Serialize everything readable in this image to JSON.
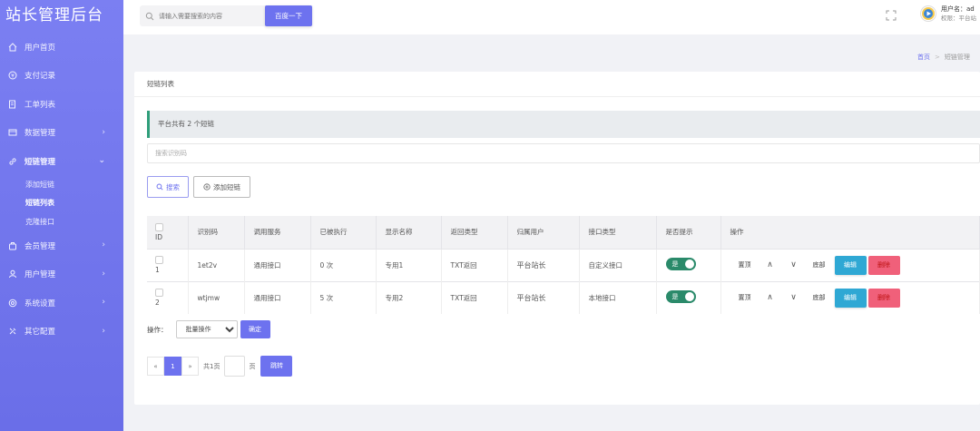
{
  "brand": "站长管理后台",
  "sidebar": {
    "items": [
      {
        "label": "用户首页",
        "icon": "home-icon"
      },
      {
        "label": "支付记录",
        "icon": "yen-icon"
      },
      {
        "label": "工单列表",
        "icon": "ticket-icon"
      },
      {
        "label": "数据管理",
        "icon": "database-icon"
      },
      {
        "label": "短链管理",
        "icon": "link-icon"
      },
      {
        "label": "会员管理",
        "icon": "members-icon"
      },
      {
        "label": "用户管理",
        "icon": "user-icon"
      },
      {
        "label": "系统设置",
        "icon": "settings-icon"
      },
      {
        "label": "其它配置",
        "icon": "tools-icon"
      }
    ],
    "sub_items": [
      "添加短链",
      "短链列表",
      "克隆接口"
    ]
  },
  "topbar": {
    "search_placeholder": "请输入需要搜索的内容",
    "search_button": "百度一下",
    "user_name": "用户名：ad",
    "user_role": "权限：平台站"
  },
  "breadcrumb": {
    "home": "首页",
    "separator": ">",
    "current": "短链管理"
  },
  "card": {
    "title": "短链列表",
    "notice": "平台共有 2 个短链",
    "filter_placeholder": "搜索识别码",
    "search_button": "搜索",
    "add_button": "添加短链"
  },
  "table": {
    "headers": [
      "ID",
      "识别码",
      "调用服务",
      "已被执行",
      "显示名称",
      "返回类型",
      "归属用户",
      "接口类型",
      "是否提示",
      "操作"
    ],
    "rows": [
      {
        "id": "1",
        "code": "1et2v",
        "service": "通用接口",
        "runs": "0 次",
        "name": "专用1",
        "return_type": "TXT返回",
        "owner": "平台站长",
        "api_type": "自定义接口",
        "prompt": "是"
      },
      {
        "id": "2",
        "code": "wtjmw",
        "service": "通用接口",
        "runs": "5 次",
        "name": "专用2",
        "return_type": "TXT返回",
        "owner": "平台站长",
        "api_type": "本地接口",
        "prompt": "是"
      }
    ],
    "row_actions": {
      "top": "置顶",
      "up": "∧",
      "down": "∨",
      "bottom": "底部",
      "edit": "编辑",
      "delete": "删除"
    }
  },
  "bulk": {
    "label": "操作：",
    "select_value": "批量操作",
    "confirm": "确定"
  },
  "pager": {
    "prev": "«",
    "current": "1",
    "next": "»",
    "total": "共1页",
    "page_unit": "页",
    "jump": "跳转"
  },
  "colors": {
    "accent": "#6d72ef",
    "sidebar": "#7275ee",
    "edit": "#2fa8d4",
    "delete": "#f0607a",
    "toggle": "#2a8a6a"
  }
}
